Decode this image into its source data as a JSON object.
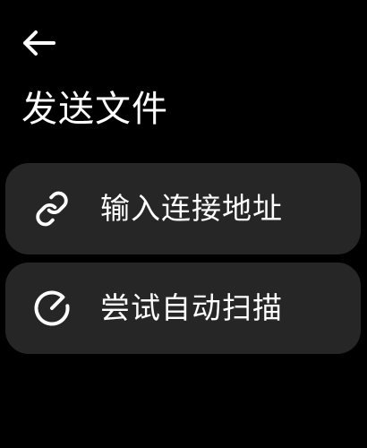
{
  "header": {
    "back_icon": "arrow-left-icon",
    "title": "发送文件"
  },
  "options": [
    {
      "icon": "link-icon",
      "label": "输入连接地址"
    },
    {
      "icon": "scan-icon",
      "label": "尝试自动扫描"
    }
  ],
  "colors": {
    "background": "#000000",
    "card": "#262626",
    "text": "#ffffff"
  }
}
